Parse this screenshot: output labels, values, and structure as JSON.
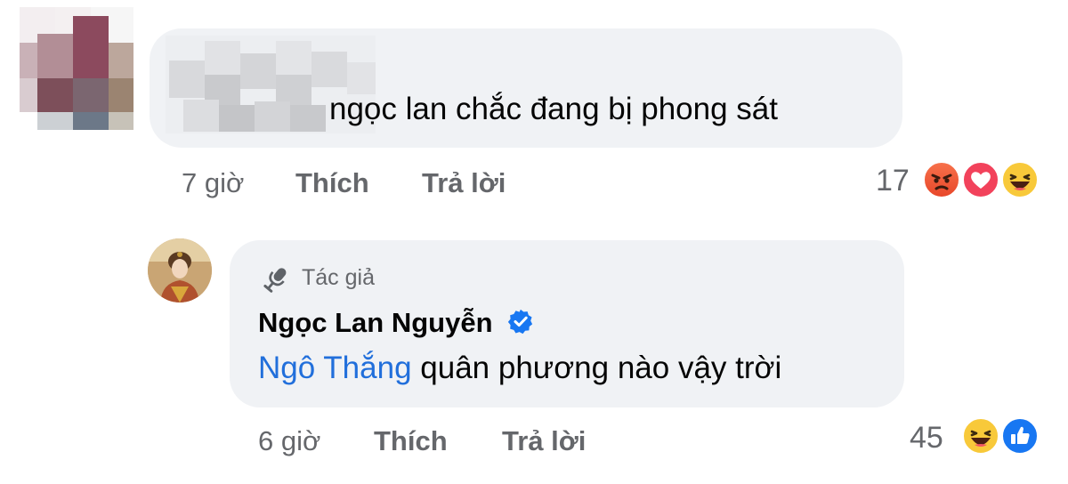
{
  "comment1": {
    "text": "ngọc lan chắc đang bị phong sát",
    "time": "7 giờ",
    "like_label": "Thích",
    "reply_label": "Trả lời",
    "reaction_count": "17",
    "reactions": [
      "angry-icon",
      "love-icon",
      "haha-icon"
    ]
  },
  "reply": {
    "author_badge": "Tác giả",
    "author_name": "Ngọc Lan Nguyễn",
    "verified_icon": "verified-badge-icon",
    "mention": "Ngô Thắng",
    "text": " quân phương nào vậy trời",
    "time": "6 giờ",
    "like_label": "Thích",
    "reply_label": "Trả lời",
    "reaction_count": "45",
    "reactions": [
      "haha-icon",
      "like-icon"
    ]
  },
  "colors": {
    "bubble": "#f0f2f5",
    "meta_text": "#65676b",
    "mention": "#216fdb",
    "verified": "#1877f2"
  }
}
